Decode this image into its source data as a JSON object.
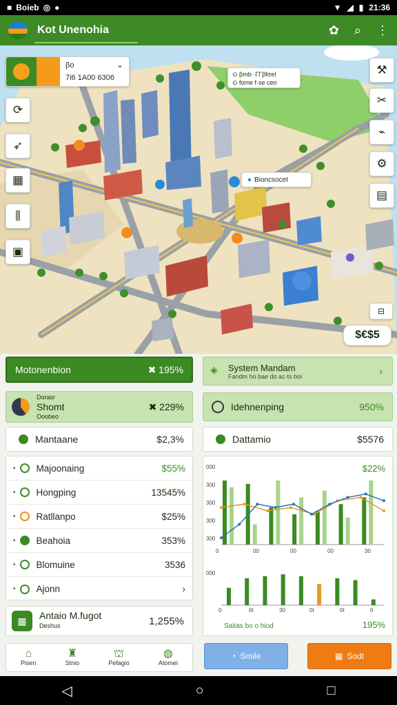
{
  "status": {
    "left1": "Boieb",
    "right_time": "21:36"
  },
  "appbar": {
    "title": "Kot Unenohia"
  },
  "map": {
    "top_panel": {
      "line1": "βo",
      "line2": "7i6 1A00 6306"
    },
    "info_box": {
      "line1": "⊙ βmb· ΓΓβfσeΙ",
      "line2": "⊙ fome f·se ceo"
    },
    "poi_label": "Bioncsocet",
    "currency": "$€$5"
  },
  "cards": {
    "c1": {
      "label": "Motonenbion",
      "value": "✖ 195%"
    },
    "c2": {
      "label": "System Mandam",
      "sub": "Fandm ho bae do ac·ts boi"
    },
    "c3": {
      "top": "Dorasr",
      "label": "Shomt",
      "sub": "Ooobeo",
      "value": "✖ 229%"
    },
    "c4": {
      "label": "Idehnenping",
      "value": "950%"
    },
    "c5": {
      "label": "Mantaane",
      "value": "$2,3%"
    },
    "c6": {
      "label": "Dattamio",
      "value": "$5576"
    }
  },
  "list": [
    {
      "label": "Majoonaing",
      "value": "$55%"
    },
    {
      "label": "Hongping",
      "value": "13545%"
    },
    {
      "label": "Ratllanpo",
      "value": "$25%"
    },
    {
      "label": "Beahoia",
      "value": "353%"
    },
    {
      "label": "Blomuine",
      "value": "3536"
    },
    {
      "label": "Ajonn",
      "value": "›"
    }
  ],
  "footer_card": {
    "label": "Antaio M.fugot",
    "sub": "Deshus",
    "value": "1,255%"
  },
  "chart_data": {
    "type": "bar",
    "top_value": "$22%",
    "footer_label": "Saitas bo o hiod",
    "footer_value": "195%",
    "y_ticks_top": [
      "300",
      "300",
      "300",
      "300"
    ],
    "x_ticks_top": [
      "0",
      "00",
      "00",
      "00",
      "30"
    ],
    "x_ticks_bottom": [
      "0·",
      "0t",
      "30",
      "0t",
      "0t",
      "0"
    ],
    "y_label_top": "000",
    "y_label_bottom": "000",
    "series_top_dark": [
      0.95,
      0.9,
      0.55,
      0.45,
      0.5,
      0.6,
      0.7
    ],
    "series_top_light": [
      0.85,
      0.3,
      0.95,
      0.7,
      0.8,
      0.4,
      0.95
    ],
    "line_blue": [
      0.1,
      0.3,
      0.6,
      0.55,
      0.6,
      0.45,
      0.6,
      0.7,
      0.75,
      0.65
    ],
    "line_orange": [
      0.55,
      0.6,
      0.5,
      0.55,
      0.45,
      0.65,
      0.7,
      0.5
    ],
    "bars_bottom": [
      0.45,
      0.7,
      0.75,
      0.8,
      0.75,
      0.55,
      0.7,
      0.65,
      0.15
    ]
  },
  "bottom_nav": [
    {
      "label": "Pisen"
    },
    {
      "label": "Stnio"
    },
    {
      "label": "Pefagio"
    },
    {
      "label": "Atomei"
    }
  ],
  "buttons": {
    "left": "Smile",
    "right": "Sodt"
  }
}
